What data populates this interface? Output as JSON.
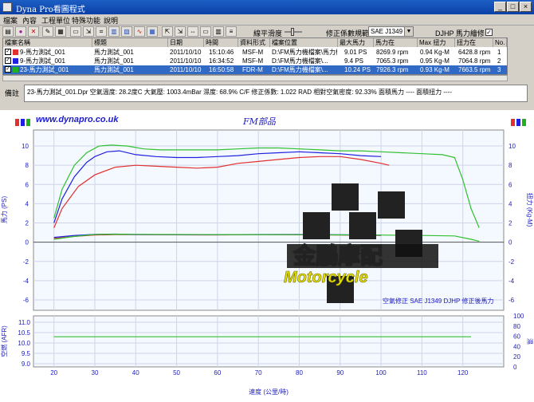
{
  "window": {
    "title": "Dyna Pro看圖程式",
    "controls": [
      "_",
      "□",
      "×"
    ]
  },
  "menu": [
    "檔案",
    "內容",
    "工程單位",
    "特殊功能",
    "說明"
  ],
  "toolbar": {
    "smoothing_label": "線平滑度",
    "correction_label": "修正係數規範",
    "correction_value": "SAE J1349",
    "djhp_label": "DJHP 馬力繪修",
    "djhp_checked": "✓"
  },
  "table": {
    "headers": [
      "檔案名稱",
      "標題",
      "日期",
      "時間",
      "資料形式",
      "檔案位置",
      "最大馬力",
      "馬力在",
      "Max 扭力",
      "扭力在",
      "No."
    ],
    "rows": [
      {
        "check": "✓",
        "color": "#e03030",
        "name": "9-馬力測試_001",
        "title": "馬力測試_001",
        "date": "2011/10/10",
        "time": "15:10:46",
        "format": "MSF-M",
        "location": "D:\\FM馬力機檔案\\馬力機...",
        "max_hp": "9.01 PS",
        "hp_at": "8269.9 rpm",
        "max_torque": "0.94 Kg-M",
        "torque_at": "6428.8 rpm",
        "no": "1"
      },
      {
        "check": "✓",
        "color": "#2020e0",
        "name": "9-馬力測試_001",
        "title": "馬力測試_001",
        "date": "2011/10/10",
        "time": "16:34:52",
        "format": "MSF-M",
        "location": "D:\\FM馬力機檔案\\...",
        "max_hp": "9.4 PS",
        "hp_at": "7065.3 rpm",
        "max_torque": "0.95 Kg-M",
        "torque_at": "7064.8 rpm",
        "no": "2"
      },
      {
        "check": "✓",
        "color": "#20b020",
        "name": "23-馬力測試_001",
        "title": "馬力測試_001",
        "date": "2011/10/10",
        "time": "16:50:58",
        "format": "FDR-M",
        "location": "D:\\FM馬力機檔案\\...",
        "max_hp": "10.24 PS",
        "hp_at": "7926.3 rpm",
        "max_torque": "0.93 Kg-M",
        "torque_at": "7663.5 rpm",
        "no": "3"
      }
    ]
  },
  "remark": {
    "label": "備註",
    "text": "23-馬力測試_001.Dpr  空氣溫度: 28.2度C  大氣壓: 1003.4mBar  濕度: 68.9%  C/F 修正係數: 1.022  RAD 相對空氣密度: 92.33%  面積馬力 ----  面積扭力 ----"
  },
  "chart_header": {
    "site": "www.dynapro.co.uk",
    "title": "FM部品",
    "swatch_colors_left": [
      "#e03030",
      "#2020e0",
      "#20b020"
    ],
    "swatch_colors_right": [
      "#e03030",
      "#2020e0",
      "#20b020"
    ]
  },
  "watermark": {
    "cn": "金鵬摩配",
    "en": "Motorcycle"
  },
  "chart_data": [
    {
      "type": "line",
      "xlim": [
        15,
        130
      ],
      "ylim": [
        -6,
        11
      ],
      "left_ticks": [
        10,
        8,
        6,
        4,
        2,
        0,
        -2,
        -4,
        -6
      ],
      "ylabel": "馬力 (PS)",
      "right_ylabel": "扭力 (Kg-M)",
      "annotation": "空氣修正 SAE J1349    DJHP 修正後馬力",
      "series": [
        {
          "color": "#e03030",
          "x": [
            20,
            22,
            26,
            30,
            35,
            40,
            45,
            50,
            55,
            60,
            65,
            70,
            75,
            80,
            85,
            90,
            95,
            100,
            102
          ],
          "y": [
            1.5,
            3.5,
            5.8,
            7.0,
            7.8,
            8.0,
            7.9,
            7.8,
            7.7,
            7.8,
            8.2,
            8.4,
            8.6,
            8.8,
            8.9,
            8.9,
            8.6,
            8.2,
            8.0
          ]
        },
        {
          "color": "#2020e0",
          "x": [
            20,
            22,
            25,
            28,
            30,
            33,
            36,
            40,
            45,
            50,
            55,
            60,
            65,
            70,
            75,
            80,
            85,
            90,
            95,
            100
          ],
          "y": [
            2.0,
            4.5,
            6.8,
            8.3,
            8.9,
            9.4,
            9.5,
            9.1,
            8.9,
            8.8,
            8.8,
            8.9,
            9.0,
            9.2,
            9.3,
            9.4,
            9.3,
            9.2,
            9.0,
            8.9
          ]
        },
        {
          "color": "#30c030",
          "x": [
            20,
            22,
            25,
            28,
            31,
            34,
            38,
            42,
            46,
            50,
            55,
            60,
            65,
            70,
            75,
            80,
            85,
            90,
            95,
            100,
            105,
            110,
            115,
            118,
            120,
            122,
            124
          ],
          "y": [
            2.5,
            5.5,
            8.0,
            9.3,
            10.0,
            10.1,
            10.0,
            9.7,
            9.6,
            9.6,
            9.6,
            9.6,
            9.7,
            9.8,
            9.8,
            9.7,
            9.6,
            9.5,
            9.5,
            9.4,
            9.3,
            9.2,
            9.1,
            8.8,
            6.5,
            3.5,
            1.5
          ]
        },
        {
          "color": "#e03030",
          "x": [
            20,
            25,
            30,
            35,
            40,
            50,
            60,
            70,
            80,
            90,
            100
          ],
          "y": [
            0.4,
            0.6,
            0.75,
            0.78,
            0.78,
            0.77,
            0.76,
            0.78,
            0.77,
            0.74,
            0.7
          ]
        },
        {
          "color": "#2020e0",
          "x": [
            20,
            25,
            30,
            35,
            40,
            50,
            60,
            70,
            80,
            90,
            100
          ],
          "y": [
            0.5,
            0.7,
            0.82,
            0.84,
            0.8,
            0.78,
            0.78,
            0.8,
            0.8,
            0.77,
            0.74
          ]
        },
        {
          "color": "#30c030",
          "x": [
            20,
            25,
            30,
            35,
            40,
            50,
            60,
            70,
            80,
            90,
            100,
            110,
            118,
            122,
            124
          ],
          "y": [
            0.3,
            0.6,
            0.8,
            0.83,
            0.82,
            0.8,
            0.79,
            0.79,
            0.78,
            0.76,
            0.74,
            0.7,
            0.65,
            0.3,
            0.1
          ]
        }
      ]
    },
    {
      "type": "line",
      "xlim": [
        15,
        130
      ],
      "ylim": [
        9,
        11
      ],
      "left_ticks": [
        11.0,
        10.5,
        10.0,
        9.5,
        9.0
      ],
      "right_ticks": [
        100,
        80,
        60,
        40,
        20,
        0
      ],
      "x_ticks": [
        20,
        30,
        40,
        50,
        60,
        70,
        80,
        90,
        100,
        110,
        120
      ],
      "ylabel": "空燃 (AFR)",
      "right_ylabel": "濕",
      "xlabel": "速度 (公里/時)",
      "series": [
        {
          "color": "#30c030",
          "x": [
            20,
            122
          ],
          "y": [
            10.3,
            10.3
          ]
        }
      ]
    }
  ]
}
